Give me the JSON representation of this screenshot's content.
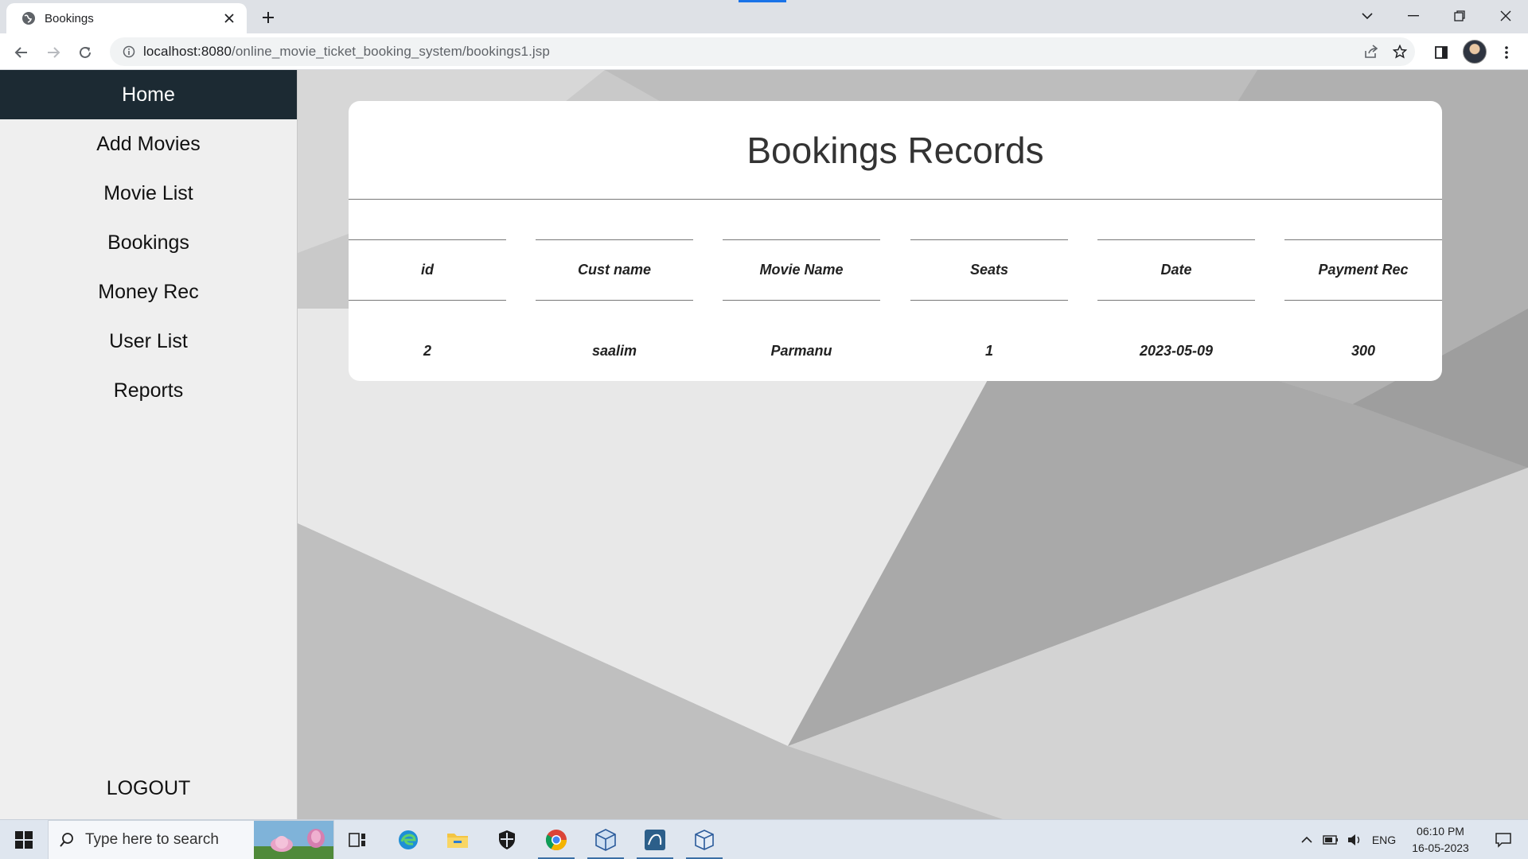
{
  "browser": {
    "tab_title": "Bookings",
    "url_host": "localhost:8080",
    "url_path": "/online_movie_ticket_booking_system/bookings1.jsp"
  },
  "sidebar": {
    "items": [
      {
        "label": "Home",
        "active": true
      },
      {
        "label": "Add Movies"
      },
      {
        "label": "Movie List"
      },
      {
        "label": "Bookings"
      },
      {
        "label": "Money Rec"
      },
      {
        "label": "User List"
      },
      {
        "label": "Reports"
      }
    ],
    "logout": "LOGOUT"
  },
  "main": {
    "title": "Bookings Records",
    "columns": [
      "id",
      "Cust name",
      "Movie Name",
      "Seats",
      "Date",
      "Payment Rec"
    ],
    "rows": [
      [
        "2",
        "saalim",
        "Parmanu",
        "1",
        "2023-05-09",
        "300"
      ]
    ]
  },
  "taskbar": {
    "search_placeholder": "Type here to search",
    "language": "ENG",
    "time": "06:10 PM",
    "date": "16-05-2023"
  },
  "colors": {
    "sidebar_active": "#1c2a33",
    "accent": "#1a73e8"
  }
}
